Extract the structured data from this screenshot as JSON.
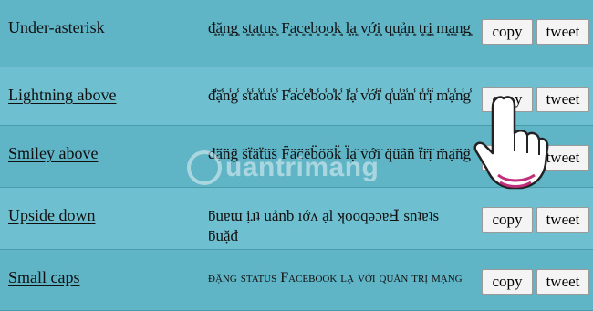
{
  "rows": [
    {
      "name": "Under-asterisk",
      "sample": "đ͙ặ͙n͙g͙ s͙t͙a͙t͙u͙s͙ F͙a͙c͙e͙b͙o͙o͙k͙ l͙ạ͙ v͙ớ͙i͙ q͙u͙ả͙n͙ t͙r͙ị͙ m͙ạ͙n͙g͙",
      "copy": "copy",
      "tweet": "tweet"
    },
    {
      "name": "Lightning above",
      "sample": "đ̾ặ̾n̾g̾ s̾t̾a̾t̾u̾s̾ F̾a̾c̾e̾b̾o̾o̾k̾ l̾ạ̾ v̾ớ̾i̾ q̾u̾ả̾n̾ t̾r̾ị̾ m̾ạ̾n̾g̾",
      "copy": "copy",
      "tweet": "tweet"
    },
    {
      "name": "Smiley above",
      "sample": "đ̈̈ặ̈̈n̈̈g̈̈ s̈̈ẗ̈ä̈ẗ̈ü̈s̈̈ F̈̈ä̈c̈̈ë̈b̈̈ö̈ö̈k̈̈ l̈̈ạ̈̈ v̈̈ớ̈̈ï̈ q̈̈ü̈ả̈̈n̈̈ ẗ̈r̈̈ị̈̈ m̈̈ạ̈̈n̈̈g̈̈",
      "copy": "copy",
      "tweet": "tweet"
    },
    {
      "name": "Upside down",
      "sample": "ƃuɐɯ ịɹʇ uảnb ıớʌ ạl ʞooqǝɔɐℲ snʇɐʇs ƃuặđ",
      "copy": "copy",
      "tweet": "tweet"
    },
    {
      "name": "Small caps",
      "sample": "đặng status Facebook lạ với quản trị mạng",
      "copy": "copy",
      "tweet": "tweet"
    }
  ],
  "watermark": "uantrimang"
}
